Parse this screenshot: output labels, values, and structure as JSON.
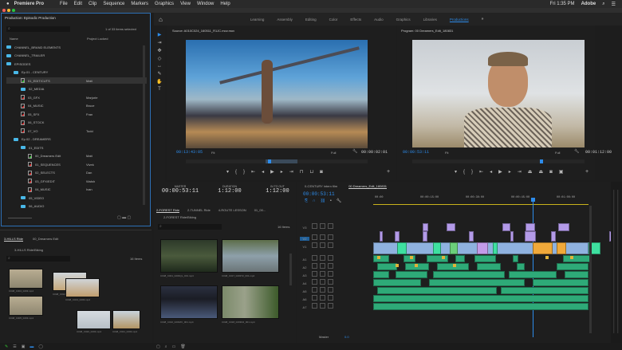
{
  "menubar": {
    "app": "Premiere Pro",
    "items": [
      "File",
      "Edit",
      "Clip",
      "Sequence",
      "Markers",
      "Graphics",
      "View",
      "Window",
      "Help"
    ],
    "clock": "Fri 1:35 PM",
    "account": "Adobe"
  },
  "workspaces": {
    "items": [
      "Learning",
      "Assembly",
      "Editing",
      "Color",
      "Effects",
      "Audio",
      "Graphics",
      "Libraries",
      "Productions"
    ],
    "active": "Productions"
  },
  "project": {
    "title": "Production: Episodic Production",
    "search_placeholder": "",
    "count": "1 of 33 items selected",
    "col_name": "Name",
    "col_locked": "Project Locked",
    "items": [
      {
        "name": "CHANNEL_BRAND ELEMENTS",
        "type": "folder",
        "owner": ""
      },
      {
        "name": "CHANNEL_TRAILER",
        "type": "folder",
        "owner": ""
      },
      {
        "name": "EPISODES",
        "type": "folder",
        "owner": ""
      },
      {
        "name": "Ep.01 - CENTURY",
        "type": "folder",
        "owner": ""
      },
      {
        "name": "01_EDIT/CUTS",
        "type": "seq-open",
        "owner": "Matt"
      },
      {
        "name": "02_MEDIA",
        "type": "folder",
        "owner": ""
      },
      {
        "name": "03_GFX",
        "type": "seq",
        "owner": "Marjorie"
      },
      {
        "name": "04_MUSIC",
        "type": "seq",
        "owner": "Bruce"
      },
      {
        "name": "05_SFX",
        "type": "seq",
        "owner": "Fran"
      },
      {
        "name": "06_STOCK",
        "type": "seq",
        "owner": ""
      },
      {
        "name": "07_VO",
        "type": "seq",
        "owner": "Todd"
      },
      {
        "name": "Ep.02 - DREAMERS",
        "type": "folder",
        "owner": ""
      },
      {
        "name": "01_EDITS",
        "type": "folder",
        "owner": ""
      },
      {
        "name": "00_Dreamers Edit",
        "type": "seq-open",
        "owner": "Matt"
      },
      {
        "name": "01_SEQUENCES",
        "type": "seq",
        "owner": "Vivek"
      },
      {
        "name": "02_SELECTS",
        "type": "seq",
        "owner": "Dan"
      },
      {
        "name": "03_GFX/EDIT",
        "type": "seq",
        "owner": "Walsh"
      },
      {
        "name": "04_MUSIC",
        "type": "seq",
        "owner": "Ivan"
      },
      {
        "name": "05_VIDEO",
        "type": "folder",
        "owner": ""
      },
      {
        "name": "06_AUDIO",
        "type": "folder",
        "owner": ""
      }
    ]
  },
  "source": {
    "title": "Source: A010C024_160511_R1JC.mov.mov",
    "timecode": "00:13:43:05",
    "fit": "Fit",
    "quality": "Full",
    "duration": "00:00:02:01"
  },
  "program": {
    "title": "Program: 00 Dreamers_Edit_180831",
    "timecode": "00:00:53:11",
    "fit": "Fit",
    "quality": "Full",
    "duration": "00:01:12:00"
  },
  "master": {
    "master_label": "MASTER",
    "master_tc": "00:00:53:11",
    "duration_label": "DURATION",
    "duration": "1:12:00",
    "inout_label": "IN TO OUT",
    "inout": "1:12:00"
  },
  "bin": {
    "tabs": [
      "2-FOREST Ride",
      "2-TUNNEL Ride",
      "4-ROUTE LESSON",
      "01_00..."
    ],
    "path": "2-FOREST Ride/Biking",
    "count": "16 Items",
    "clips": [
      "C048_C001_0203QL_001.mp4",
      "C048_C017_0203T2_001.mp4",
      "C048_C010_0203ZV_001.mp4",
      "C048_C018_0203D2_001.mp4"
    ]
  },
  "bin2": {
    "tabs": [
      "3-HILLS Ride",
      "00_Dreamers Edit"
    ],
    "path": "3-HILLS Ride/Biking",
    "count": "16 Items",
    "clips": [
      "C048_C004_0203.mp4",
      "C048_C012_0203.mp4",
      "C048_C013_0203.mp4",
      "C048_C005_0203.mp4",
      "C048_C020_0203.mp4",
      "C048_C021_0203.mp4"
    ]
  },
  "timeline": {
    "tabs": [
      "0-CENTURY intern film",
      "00 Dreamers_Edit_180831"
    ],
    "timecode": "00:00:53:11",
    "ruler": [
      "00:00",
      "00:00:15:00",
      "00:00:30:00",
      "00:00:45:00",
      "00:01:00:00"
    ],
    "playhead_fraction": 0.74,
    "tracks": [
      "V3",
      "V2",
      "V1",
      "A1",
      "A2",
      "A3",
      "A4",
      "A5",
      "A6",
      "A7"
    ],
    "master_label": "Master",
    "master_value": "0.0"
  },
  "colors": {
    "accent": "#2d8ceb",
    "video_clip": "#8fb2df",
    "graphics_clip": "#b39ae8",
    "audio_clip": "#2eaa78",
    "marker": "#e0b33a",
    "work_area": "#c9b21c"
  }
}
